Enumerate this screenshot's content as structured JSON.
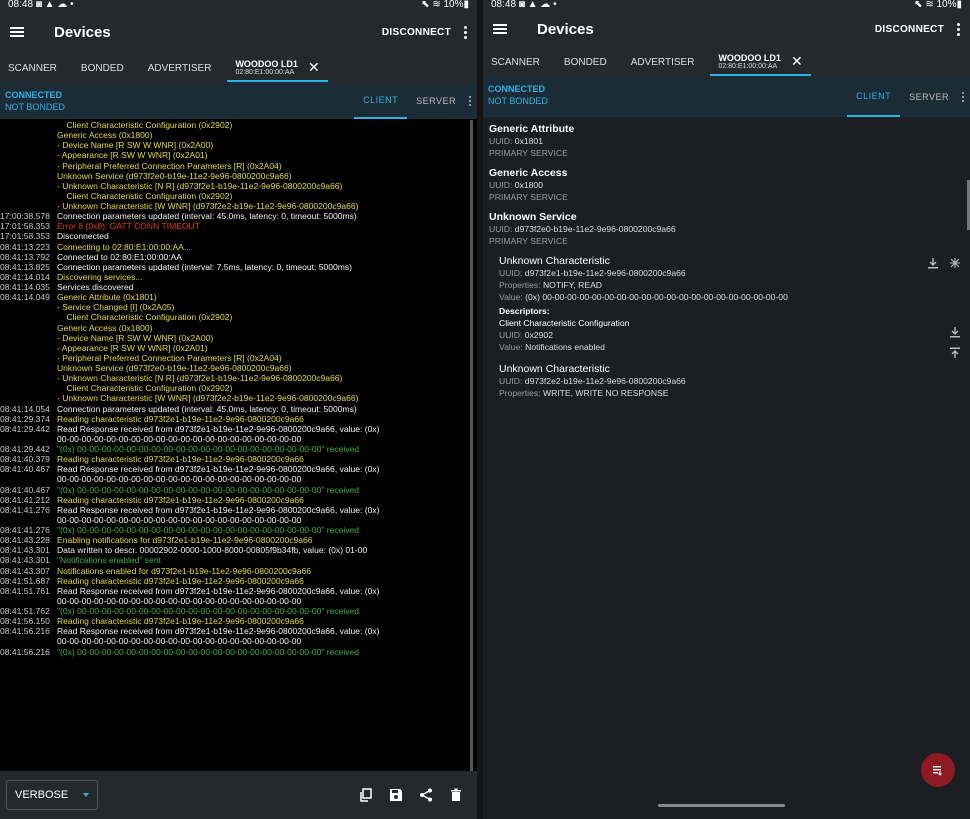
{
  "left": {
    "status": {
      "time": "08:48",
      "icons": "◙ ▲ ☁ •",
      "right": "⬉ ≋ 10%▮"
    },
    "appbar": {
      "title": "Devices",
      "disconnect": "DISCONNECT"
    },
    "tabs": {
      "scanner": "SCANNER",
      "bonded": "BONDED",
      "advertiser": "ADVERTISER",
      "device_name": "WOODOO LD1",
      "device_addr": "02:80:E1:00:00:AA"
    },
    "conn": {
      "state": "CONNECTED",
      "bond": "NOT BONDED",
      "client": "CLIENT",
      "server": "SERVER"
    },
    "log": [
      {
        "t": "",
        "c": "yellow",
        "m": "    Client Characteristic Configuration (0x2902)"
      },
      {
        "t": "",
        "c": "yellow",
        "m": "Generic Access (0x1800)"
      },
      {
        "t": "",
        "c": "yellow",
        "m": "- Device Name [R SW W WNR] (0x2A00)"
      },
      {
        "t": "",
        "c": "yellow",
        "m": "- Appearance [R SW W WNR] (0x2A01)"
      },
      {
        "t": "",
        "c": "yellow",
        "m": "- Peripheral Preferred Connection Parameters [R] (0x2A04)"
      },
      {
        "t": "",
        "c": "yellow",
        "m": "Unknown Service (d973f2e0-b19e-11e2-9e96-0800200c9a66)"
      },
      {
        "t": "",
        "c": "yellow",
        "m": "- Unknown Characteristic [N R] (d973f2e1-b19e-11e2-9e96-0800200c9a66)"
      },
      {
        "t": "",
        "c": "yellow",
        "m": "    Client Characteristic Configuration (0x2902)"
      },
      {
        "t": "",
        "c": "yellow",
        "m": "- Unknown Characteristic [W WNR] (d973f2e2-b19e-11e2-9e96-0800200c9a66)"
      },
      {
        "t": "17:00:38.578",
        "c": "white",
        "m": "Connection parameters updated (interval: 45.0ms, latency: 0, timeout: 5000ms)"
      },
      {
        "t": "17:01:58.353",
        "c": "red",
        "m": "Error 8 (0x8): GATT CONN TIMEOUT"
      },
      {
        "t": "17:01:58.353",
        "c": "white",
        "m": "Disconnected"
      },
      {
        "t": "08:41:13.223",
        "c": "yellow",
        "m": "Connecting to 02:80:E1:00:00:AA..."
      },
      {
        "t": "08:41:13.792",
        "c": "white",
        "m": "Connected to 02:80:E1:00:00:AA"
      },
      {
        "t": "08:41:13.825",
        "c": "white",
        "m": "Connection parameters updated (interval: 7.5ms, latency: 0, timeout: 5000ms)"
      },
      {
        "t": "08:41:14.014",
        "c": "yellow",
        "m": "Discovering services..."
      },
      {
        "t": "08:41:14.035",
        "c": "white",
        "m": "Services discovered"
      },
      {
        "t": "08:41:14.049",
        "c": "yellow",
        "m": "Generic Attribute (0x1801)"
      },
      {
        "t": "",
        "c": "yellow",
        "m": "- Service Changed [I] (0x2A05)"
      },
      {
        "t": "",
        "c": "yellow",
        "m": "    Client Characteristic Configuration (0x2902)"
      },
      {
        "t": "",
        "c": "yellow",
        "m": "Generic Access (0x1800)"
      },
      {
        "t": "",
        "c": "yellow",
        "m": "- Device Name [R SW W WNR] (0x2A00)"
      },
      {
        "t": "",
        "c": "yellow",
        "m": "- Appearance [R SW W WNR] (0x2A01)"
      },
      {
        "t": "",
        "c": "yellow",
        "m": "- Peripheral Preferred Connection Parameters [R] (0x2A04)"
      },
      {
        "t": "",
        "c": "yellow",
        "m": "Unknown Service (d973f2e0-b19e-11e2-9e96-0800200c9a66)"
      },
      {
        "t": "",
        "c": "yellow",
        "m": "- Unknown Characteristic [N R] (d973f2e1-b19e-11e2-9e96-0800200c9a66)"
      },
      {
        "t": "",
        "c": "yellow",
        "m": "    Client Characteristic Configuration (0x2902)"
      },
      {
        "t": "",
        "c": "yellow",
        "m": "- Unknown Characteristic [W WNR] (d973f2e2-b19e-11e2-9e96-0800200c9a66)"
      },
      {
        "t": "08:41:14.054",
        "c": "white",
        "m": "Connection parameters updated (interval: 45.0ms, latency: 0, timeout: 5000ms)"
      },
      {
        "t": "08:41:29.374",
        "c": "yellow",
        "m": "Reading characteristic d973f2e1-b19e-11e2-9e96-0800200c9a66"
      },
      {
        "t": "08:41:29.442",
        "c": "white",
        "m": "Read Response received from d973f2e1-b19e-11e2-9e96-0800200c9a66, value: (0x)"
      },
      {
        "t": "",
        "c": "white",
        "m": "00-00-00-00-00-00-00-00-00-00-00-00-00-00-00-00-00-00-00-00"
      },
      {
        "t": "08:41:29.442",
        "c": "green",
        "m": "\"(0x) 00-00-00-00-00-00-00-00-00-00-00-00-00-00-00-00-00-00-00-00\" received"
      },
      {
        "t": "08:41:40.379",
        "c": "yellow",
        "m": "Reading characteristic d973f2e1-b19e-11e2-9e96-0800200c9a66"
      },
      {
        "t": "08:41:40.467",
        "c": "white",
        "m": "Read Response received from d973f2e1-b19e-11e2-9e96-0800200c9a66, value: (0x)"
      },
      {
        "t": "",
        "c": "white",
        "m": "00-00-00-00-00-00-00-00-00-00-00-00-00-00-00-00-00-00-00-00"
      },
      {
        "t": "08:41:40.467",
        "c": "green",
        "m": "\"(0x) 00-00-00-00-00-00-00-00-00-00-00-00-00-00-00-00-00-00-00-00\" received"
      },
      {
        "t": "08:41:41.212",
        "c": "yellow",
        "m": "Reading characteristic d973f2e1-b19e-11e2-9e96-0800200c9a66"
      },
      {
        "t": "08:41:41.276",
        "c": "white",
        "m": "Read Response received from d973f2e1-b19e-11e2-9e96-0800200c9a66, value: (0x)"
      },
      {
        "t": "",
        "c": "white",
        "m": "00-00-00-00-00-00-00-00-00-00-00-00-00-00-00-00-00-00-00-00"
      },
      {
        "t": "08:41:41.276",
        "c": "green",
        "m": "\"(0x) 00-00-00-00-00-00-00-00-00-00-00-00-00-00-00-00-00-00-00-00\" received"
      },
      {
        "t": "08:41:43.228",
        "c": "yellow",
        "m": "Enabling notifications for d973f2e1-b19e-11e2-9e96-0800200c9a66"
      },
      {
        "t": "08:41:43.301",
        "c": "white",
        "m": "Data written to descr. 00002902-0000-1000-8000-00805f9b34fb, value: (0x) 01-00"
      },
      {
        "t": "08:41:43.301",
        "c": "green",
        "m": "\"Notifications enabled\" sent"
      },
      {
        "t": "08:41:43.307",
        "c": "yellow",
        "m": "Notifications enabled for d973f2e1-b19e-11e2-9e96-0800200c9a66"
      },
      {
        "t": "08:41:51.687",
        "c": "yellow",
        "m": "Reading characteristic d973f2e1-b19e-11e2-9e96-0800200c9a66"
      },
      {
        "t": "08:41:51.761",
        "c": "white",
        "m": "Read Response received from d973f2e1-b19e-11e2-9e96-0800200c9a66, value: (0x)"
      },
      {
        "t": "",
        "c": "white",
        "m": "00-00-00-00-00-00-00-00-00-00-00-00-00-00-00-00-00-00-00-00"
      },
      {
        "t": "08:41:51.762",
        "c": "green",
        "m": "\"(0x) 00-00-00-00-00-00-00-00-00-00-00-00-00-00-00-00-00-00-00-00\" received"
      },
      {
        "t": "08:41:56.150",
        "c": "yellow",
        "m": "Reading characteristic d973f2e1-b19e-11e2-9e96-0800200c9a66"
      },
      {
        "t": "08:41:56.216",
        "c": "white",
        "m": "Read Response received from d973f2e1-b19e-11e2-9e96-0800200c9a66, value: (0x)"
      },
      {
        "t": "",
        "c": "white",
        "m": "00-00-00-00-00-00-00-00-00-00-00-00-00-00-00-00-00-00-00-00"
      },
      {
        "t": "08:41:56.216",
        "c": "green",
        "m": "\"(0x) 00-00-00-00-00-00-00-00-00-00-00-00-00-00-00-00-00-00-00-00\" received"
      }
    ],
    "bottom": {
      "level": "VERBOSE"
    }
  },
  "right": {
    "status": {
      "time": "08:48",
      "icons": "◙ ▲ ☁ •",
      "right": "⬉ ≋ 10%▮"
    },
    "appbar": {
      "title": "Devices",
      "disconnect": "DISCONNECT"
    },
    "tabs": {
      "scanner": "SCANNER",
      "bonded": "BONDED",
      "advertiser": "ADVERTISER",
      "device_name": "WOODOO LD1",
      "device_addr": "02:80:E1:00:00:AA"
    },
    "conn": {
      "state": "CONNECTED",
      "bond": "NOT BONDED",
      "client": "CLIENT",
      "server": "SERVER"
    },
    "uuid_label": "UUID:",
    "properties_label": "Properties:",
    "value_label": "Value:",
    "services": [
      {
        "name": "Generic Attribute",
        "uuid": "0x1801",
        "type": "PRIMARY SERVICE"
      },
      {
        "name": "Generic Access",
        "uuid": "0x1800",
        "type": "PRIMARY SERVICE"
      },
      {
        "name": "Unknown Service",
        "uuid": "d973f2e0-b19e-11e2-9e96-0800200c9a66",
        "type": "PRIMARY SERVICE"
      }
    ],
    "characteristics": [
      {
        "name": "Unknown Characteristic",
        "uuid": "d973f2e1-b19e-11e2-9e96-0800200c9a66",
        "properties": "NOTIFY, READ",
        "value": "(0x) 00-00-00-00-00-00-00-00-00-00-00-00-00-00-00-00-00-00-00-00",
        "descriptors_heading": "Descriptors:",
        "descriptor_name": "Client Characteristic Configuration",
        "descriptor_uuid": "0x2902",
        "descriptor_value": "Notifications enabled"
      },
      {
        "name": "Unknown Characteristic",
        "uuid": "d973f2e2-b19e-11e2-9e96-0800200c9a66",
        "properties": "WRITE, WRITE NO RESPONSE"
      }
    ]
  },
  "colors": {
    "accent": "#2bb3e3",
    "bar": "#26292c",
    "fab": "#8e1a23",
    "log_yellow": "#e5dd26",
    "log_green": "#3cb33c",
    "log_red": "#e53935"
  }
}
